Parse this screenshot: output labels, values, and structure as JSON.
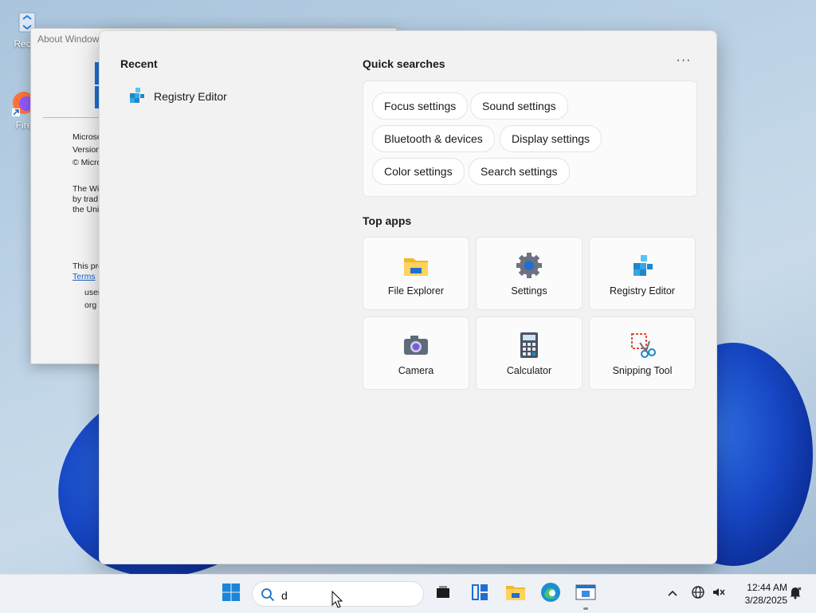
{
  "desktop": {
    "icons": [
      {
        "label": "Recyc",
        "name": "recycle-bin-icon"
      },
      {
        "label": "Fire",
        "name": "firefox-icon"
      }
    ]
  },
  "about_window": {
    "title": "About Window",
    "lines": [
      "Microso",
      "Version",
      "© Micro",
      "The Wi",
      "by trad",
      "the Uni",
      "This pro",
      "Terms",
      "user",
      "org"
    ]
  },
  "flyout": {
    "recent_title": "Recent",
    "recent_items": [
      {
        "label": "Registry Editor",
        "icon": "registry-editor-icon"
      }
    ],
    "quick_searches_title": "Quick searches",
    "more_label": "···",
    "quick_searches": [
      "Focus settings",
      "Sound settings",
      "Bluetooth & devices",
      "Display settings",
      "Color settings",
      "Search settings"
    ],
    "top_apps_title": "Top apps",
    "top_apps": [
      {
        "label": "File Explorer",
        "icon": "file-explorer-icon"
      },
      {
        "label": "Settings",
        "icon": "settings-gear-icon"
      },
      {
        "label": "Registry Editor",
        "icon": "registry-editor-icon"
      },
      {
        "label": "Camera",
        "icon": "camera-icon"
      },
      {
        "label": "Calculator",
        "icon": "calculator-icon"
      },
      {
        "label": "Snipping Tool",
        "icon": "snipping-tool-icon"
      }
    ]
  },
  "taskbar": {
    "search_value": "d",
    "time": "12:44 AM",
    "date": "3/28/2025",
    "apps": [
      "task-view-icon",
      "widgets-icon",
      "file-explorer-icon",
      "edge-icon",
      "about-window-icon"
    ]
  },
  "colors": {
    "accent": "#0067c0",
    "wallpaper_bloom": "#1747c5"
  }
}
